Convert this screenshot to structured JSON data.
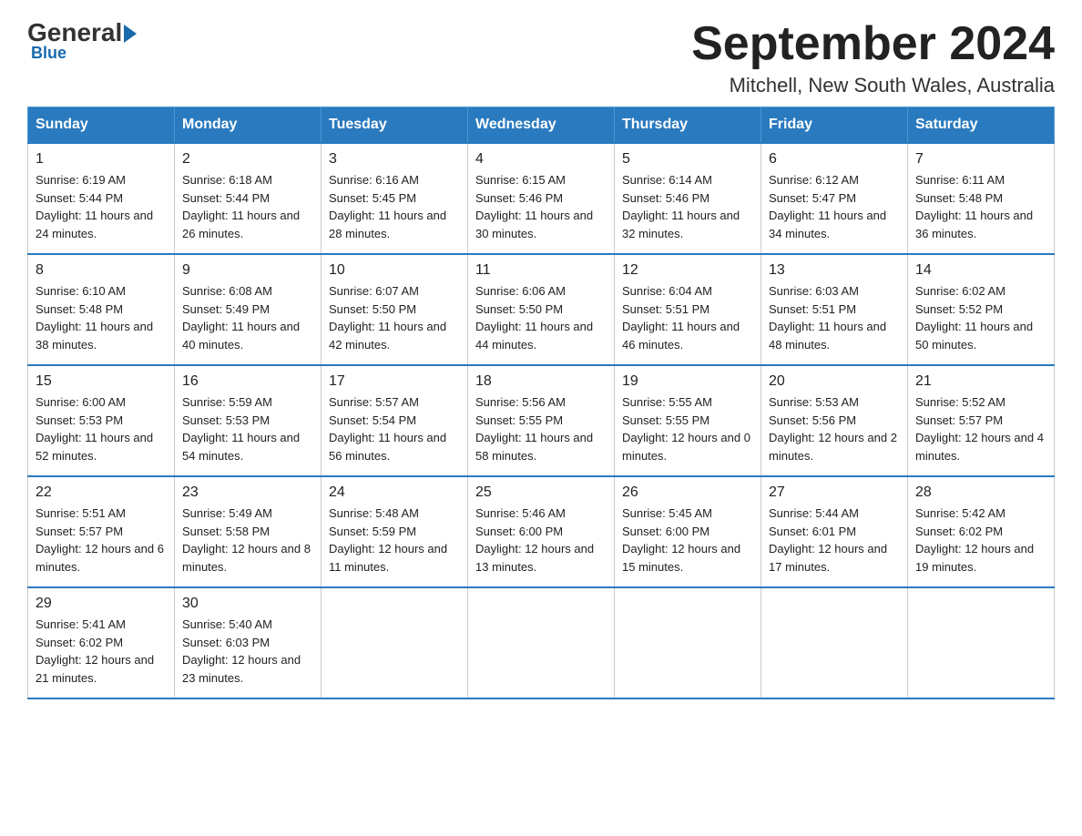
{
  "header": {
    "logo": {
      "general": "General",
      "blue": "Blue"
    },
    "title": "September 2024",
    "location": "Mitchell, New South Wales, Australia"
  },
  "calendar": {
    "days": [
      "Sunday",
      "Monday",
      "Tuesday",
      "Wednesday",
      "Thursday",
      "Friday",
      "Saturday"
    ],
    "weeks": [
      [
        {
          "day": "1",
          "sunrise": "6:19 AM",
          "sunset": "5:44 PM",
          "daylight": "11 hours and 24 minutes."
        },
        {
          "day": "2",
          "sunrise": "6:18 AM",
          "sunset": "5:44 PM",
          "daylight": "11 hours and 26 minutes."
        },
        {
          "day": "3",
          "sunrise": "6:16 AM",
          "sunset": "5:45 PM",
          "daylight": "11 hours and 28 minutes."
        },
        {
          "day": "4",
          "sunrise": "6:15 AM",
          "sunset": "5:46 PM",
          "daylight": "11 hours and 30 minutes."
        },
        {
          "day": "5",
          "sunrise": "6:14 AM",
          "sunset": "5:46 PM",
          "daylight": "11 hours and 32 minutes."
        },
        {
          "day": "6",
          "sunrise": "6:12 AM",
          "sunset": "5:47 PM",
          "daylight": "11 hours and 34 minutes."
        },
        {
          "day": "7",
          "sunrise": "6:11 AM",
          "sunset": "5:48 PM",
          "daylight": "11 hours and 36 minutes."
        }
      ],
      [
        {
          "day": "8",
          "sunrise": "6:10 AM",
          "sunset": "5:48 PM",
          "daylight": "11 hours and 38 minutes."
        },
        {
          "day": "9",
          "sunrise": "6:08 AM",
          "sunset": "5:49 PM",
          "daylight": "11 hours and 40 minutes."
        },
        {
          "day": "10",
          "sunrise": "6:07 AM",
          "sunset": "5:50 PM",
          "daylight": "11 hours and 42 minutes."
        },
        {
          "day": "11",
          "sunrise": "6:06 AM",
          "sunset": "5:50 PM",
          "daylight": "11 hours and 44 minutes."
        },
        {
          "day": "12",
          "sunrise": "6:04 AM",
          "sunset": "5:51 PM",
          "daylight": "11 hours and 46 minutes."
        },
        {
          "day": "13",
          "sunrise": "6:03 AM",
          "sunset": "5:51 PM",
          "daylight": "11 hours and 48 minutes."
        },
        {
          "day": "14",
          "sunrise": "6:02 AM",
          "sunset": "5:52 PM",
          "daylight": "11 hours and 50 minutes."
        }
      ],
      [
        {
          "day": "15",
          "sunrise": "6:00 AM",
          "sunset": "5:53 PM",
          "daylight": "11 hours and 52 minutes."
        },
        {
          "day": "16",
          "sunrise": "5:59 AM",
          "sunset": "5:53 PM",
          "daylight": "11 hours and 54 minutes."
        },
        {
          "day": "17",
          "sunrise": "5:57 AM",
          "sunset": "5:54 PM",
          "daylight": "11 hours and 56 minutes."
        },
        {
          "day": "18",
          "sunrise": "5:56 AM",
          "sunset": "5:55 PM",
          "daylight": "11 hours and 58 minutes."
        },
        {
          "day": "19",
          "sunrise": "5:55 AM",
          "sunset": "5:55 PM",
          "daylight": "12 hours and 0 minutes."
        },
        {
          "day": "20",
          "sunrise": "5:53 AM",
          "sunset": "5:56 PM",
          "daylight": "12 hours and 2 minutes."
        },
        {
          "day": "21",
          "sunrise": "5:52 AM",
          "sunset": "5:57 PM",
          "daylight": "12 hours and 4 minutes."
        }
      ],
      [
        {
          "day": "22",
          "sunrise": "5:51 AM",
          "sunset": "5:57 PM",
          "daylight": "12 hours and 6 minutes."
        },
        {
          "day": "23",
          "sunrise": "5:49 AM",
          "sunset": "5:58 PM",
          "daylight": "12 hours and 8 minutes."
        },
        {
          "day": "24",
          "sunrise": "5:48 AM",
          "sunset": "5:59 PM",
          "daylight": "12 hours and 11 minutes."
        },
        {
          "day": "25",
          "sunrise": "5:46 AM",
          "sunset": "6:00 PM",
          "daylight": "12 hours and 13 minutes."
        },
        {
          "day": "26",
          "sunrise": "5:45 AM",
          "sunset": "6:00 PM",
          "daylight": "12 hours and 15 minutes."
        },
        {
          "day": "27",
          "sunrise": "5:44 AM",
          "sunset": "6:01 PM",
          "daylight": "12 hours and 17 minutes."
        },
        {
          "day": "28",
          "sunrise": "5:42 AM",
          "sunset": "6:02 PM",
          "daylight": "12 hours and 19 minutes."
        }
      ],
      [
        {
          "day": "29",
          "sunrise": "5:41 AM",
          "sunset": "6:02 PM",
          "daylight": "12 hours and 21 minutes."
        },
        {
          "day": "30",
          "sunrise": "5:40 AM",
          "sunset": "6:03 PM",
          "daylight": "12 hours and 23 minutes."
        },
        null,
        null,
        null,
        null,
        null
      ]
    ],
    "labels": {
      "sunrise": "Sunrise:",
      "sunset": "Sunset:",
      "daylight": "Daylight:"
    }
  }
}
